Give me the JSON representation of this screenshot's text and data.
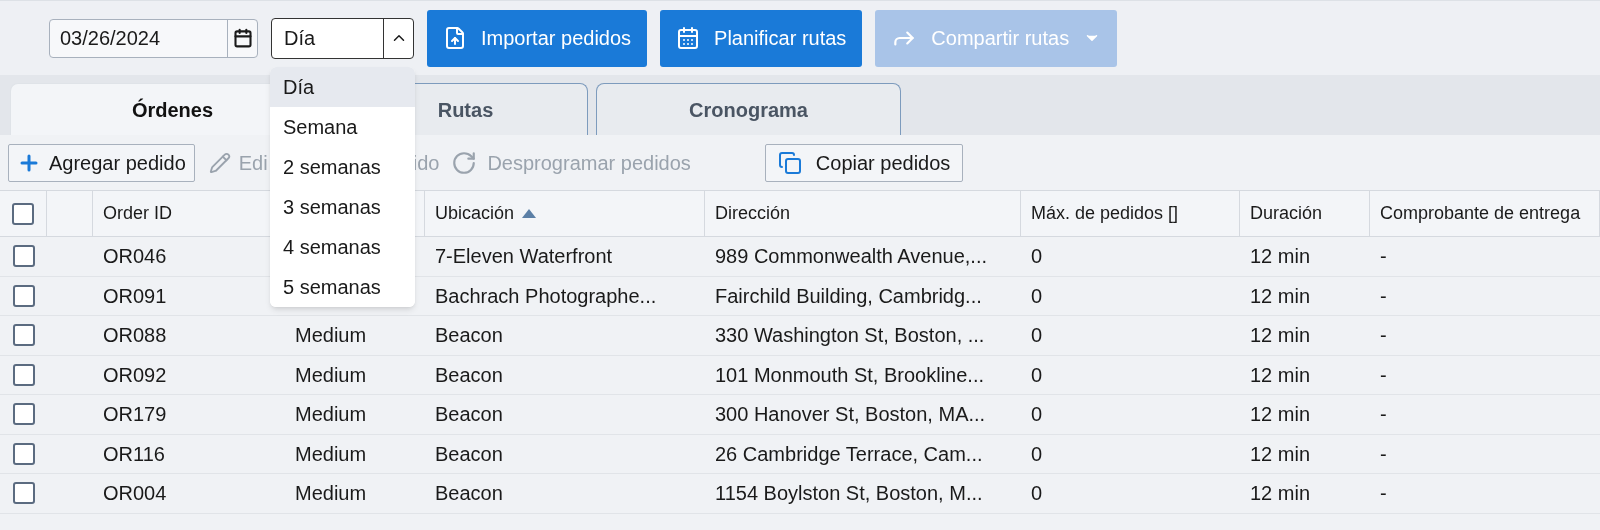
{
  "toolbar": {
    "date": "03/26/2024",
    "period": "Día",
    "buttons": [
      {
        "label": "Importar pedidos",
        "kind": "import",
        "disabled": false
      },
      {
        "label": "Planificar rutas",
        "kind": "plan",
        "disabled": false
      },
      {
        "label": "Compartir rutas",
        "kind": "share",
        "disabled": true
      }
    ]
  },
  "period_menu": {
    "expanded": true,
    "options": [
      {
        "label": "Día",
        "selected": true
      },
      {
        "label": "Semana",
        "selected": false
      },
      {
        "label": "2 semanas",
        "selected": false
      },
      {
        "label": "3 semanas",
        "selected": false
      },
      {
        "label": "4 semanas",
        "selected": false
      },
      {
        "label": "5 semanas",
        "selected": false
      }
    ]
  },
  "tabs": [
    {
      "label": "Órdenes",
      "selected": true
    },
    {
      "label": "Rutas",
      "selected": false
    },
    {
      "label": "Cronograma",
      "selected": false
    }
  ],
  "actions": {
    "add": "Agregar pedido",
    "edit_start": "Edi",
    "edit_end": "ido",
    "unschedule": "Desprogramar pedidos",
    "copy": "Copiar pedidos"
  },
  "table": {
    "all_checked": false,
    "columns": [
      {
        "label": "Order ID"
      },
      {},
      {
        "label": "Ubicación",
        "sorted": true
      },
      {
        "label": "Dirección"
      },
      {
        "label": "Máx. de pedidos []"
      },
      {
        "label": "Duración"
      },
      {
        "label": "Comprobante de entrega"
      }
    ],
    "rows": [
      {
        "checked": false,
        "cells": [
          "OR046",
          null,
          "7-Eleven Waterfront",
          "989 Commonwealth Avenue,...",
          "0",
          "12 min",
          "-"
        ]
      },
      {
        "checked": false,
        "cells": [
          "OR091",
          null,
          "Bachrach Photographe...",
          "Fairchild Building, Cambridg...",
          "0",
          "12 min",
          "-"
        ]
      },
      {
        "checked": false,
        "cells": [
          "OR088",
          "Medium",
          "Beacon",
          "330 Washington St, Boston, ...",
          "0",
          "12 min",
          "-"
        ]
      },
      {
        "checked": false,
        "cells": [
          "OR092",
          "Medium",
          "Beacon",
          "101 Monmouth St, Brookline...",
          "0",
          "12 min",
          "-"
        ]
      },
      {
        "checked": false,
        "cells": [
          "OR179",
          "Medium",
          "Beacon",
          "300 Hanover St, Boston, MA...",
          "0",
          "12 min",
          "-"
        ]
      },
      {
        "checked": false,
        "cells": [
          "OR116",
          "Medium",
          "Beacon",
          "26 Cambridge Terrace, Cam...",
          "0",
          "12 min",
          "-"
        ]
      },
      {
        "checked": false,
        "cells": [
          "OR004",
          "Medium",
          "Beacon",
          "1154 Boylston St, Boston, M...",
          "0",
          "12 min",
          "-"
        ]
      }
    ]
  }
}
